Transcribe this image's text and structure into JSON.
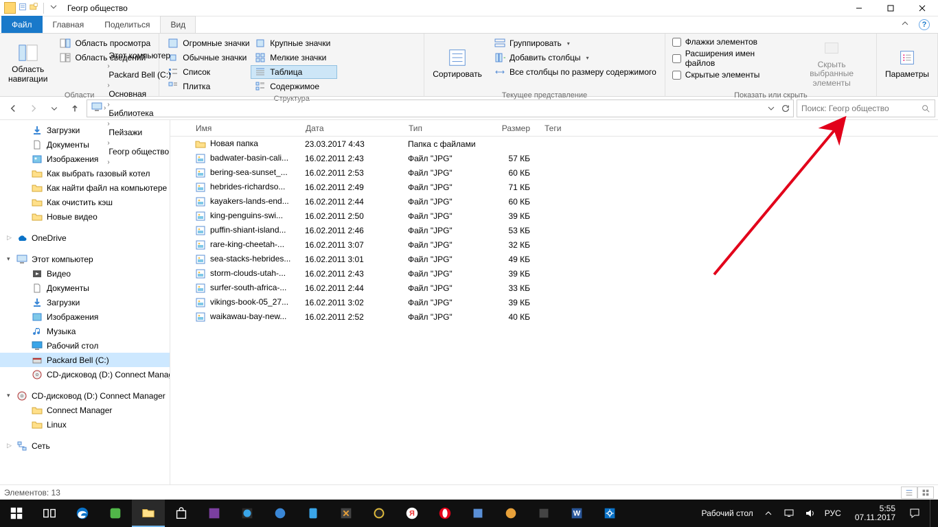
{
  "title": "Геогр общество",
  "tabs": {
    "file": "Файл",
    "home": "Главная",
    "share": "Поделиться",
    "view": "Вид"
  },
  "ribbon": {
    "nav_pane": "Область\nнавигации",
    "preview_pane": "Область просмотра",
    "details_pane": "Область сведений",
    "panes_label": "Области",
    "huge": "Огромные значки",
    "large": "Крупные значки",
    "medium": "Обычные значки",
    "small": "Мелкие значки",
    "list": "Список",
    "details": "Таблица",
    "tiles": "Плитка",
    "content": "Содержимое",
    "layout_label": "Структура",
    "sort": "Сортировать",
    "group": "Группировать",
    "addcols": "Добавить столбцы",
    "sizecols": "Все столбцы по размеру содержимого",
    "curview_label": "Текущее представление",
    "chk_boxes": "Флажки элементов",
    "chk_ext": "Расширения имен файлов",
    "chk_hidden": "Скрытые элементы",
    "hide": "Скрыть выбранные\nэлементы",
    "showhide_label": "Показать или скрыть",
    "options": "Параметры"
  },
  "breadcrumb": [
    "Этот компьютер",
    "Packard Bell (C:)",
    "Основная",
    "Библиотека",
    "Пейзажи",
    "Геогр общество"
  ],
  "search_placeholder": "Поиск: Геогр общество",
  "tree": {
    "downloads": "Загрузки",
    "documents": "Документы",
    "pictures": "Изображения",
    "t1": "Как выбрать газовый котел",
    "t2": "Как найти файл на компьютере",
    "t3": "Как очистить кэш",
    "t4": "Новые видео",
    "onedrive": "OneDrive",
    "thispc": "Этот компьютер",
    "videos": "Видео",
    "documents2": "Документы",
    "downloads2": "Загрузки",
    "pictures2": "Изображения",
    "music": "Музыка",
    "desktop": "Рабочий стол",
    "pbell": "Packard Bell (C:)",
    "cd1": "CD-дисковод (D:) Connect Manager",
    "cd2": "CD-дисковод (D:) Connect Manager",
    "cm": "Connect Manager",
    "linux": "Linux",
    "network": "Сеть"
  },
  "cols": {
    "name": "Имя",
    "date": "Дата",
    "type": "Тип",
    "size": "Размер",
    "tags": "Теги"
  },
  "rows": [
    {
      "name": "Новая папка",
      "date": "23.03.2017 4:43",
      "type": "Папка с файлами",
      "size": "",
      "folder": true
    },
    {
      "name": "badwater-basin-cali...",
      "date": "16.02.2011 2:43",
      "type": "Файл \"JPG\"",
      "size": "57 КБ"
    },
    {
      "name": "bering-sea-sunset_...",
      "date": "16.02.2011 2:53",
      "type": "Файл \"JPG\"",
      "size": "60 КБ"
    },
    {
      "name": "hebrides-richardso...",
      "date": "16.02.2011 2:49",
      "type": "Файл \"JPG\"",
      "size": "71 КБ"
    },
    {
      "name": "kayakers-lands-end...",
      "date": "16.02.2011 2:44",
      "type": "Файл \"JPG\"",
      "size": "60 КБ"
    },
    {
      "name": "king-penguins-swi...",
      "date": "16.02.2011 2:50",
      "type": "Файл \"JPG\"",
      "size": "39 КБ"
    },
    {
      "name": "puffin-shiant-island...",
      "date": "16.02.2011 2:46",
      "type": "Файл \"JPG\"",
      "size": "53 КБ"
    },
    {
      "name": "rare-king-cheetah-...",
      "date": "16.02.2011 3:07",
      "type": "Файл \"JPG\"",
      "size": "32 КБ"
    },
    {
      "name": "sea-stacks-hebrides...",
      "date": "16.02.2011 3:01",
      "type": "Файл \"JPG\"",
      "size": "49 КБ"
    },
    {
      "name": "storm-clouds-utah-...",
      "date": "16.02.2011 2:43",
      "type": "Файл \"JPG\"",
      "size": "39 КБ"
    },
    {
      "name": "surfer-south-africa-...",
      "date": "16.02.2011 2:44",
      "type": "Файл \"JPG\"",
      "size": "33 КБ"
    },
    {
      "name": "vikings-book-05_27...",
      "date": "16.02.2011 3:02",
      "type": "Файл \"JPG\"",
      "size": "39 КБ"
    },
    {
      "name": "waikawau-bay-new...",
      "date": "16.02.2011 2:52",
      "type": "Файл \"JPG\"",
      "size": "40 КБ"
    }
  ],
  "status": "Элементов: 13",
  "tray": {
    "desktop": "Рабочий стол",
    "lang": "РУС",
    "time": "5:55",
    "date": "07.11.2017"
  }
}
